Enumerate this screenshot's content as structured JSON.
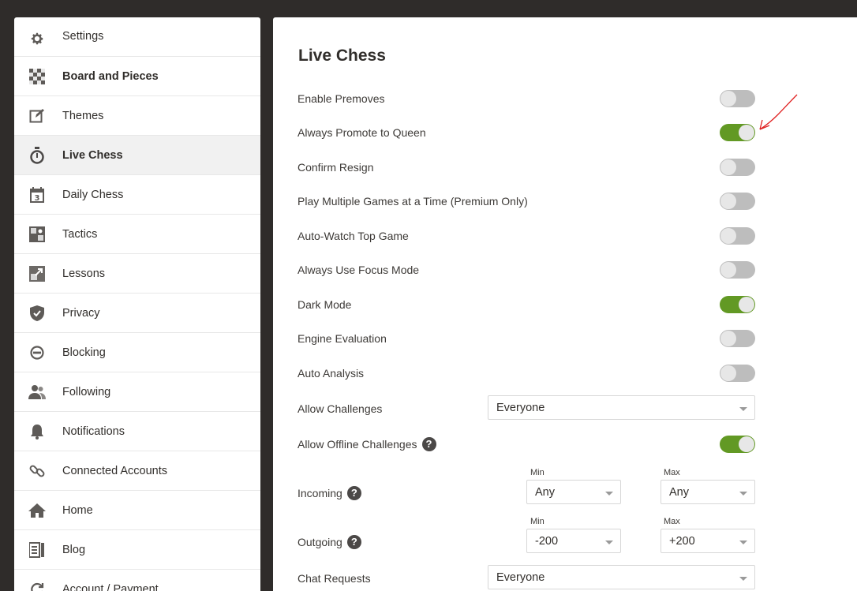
{
  "sidebar": {
    "items": [
      {
        "label": "Settings",
        "icon": "gear-icon"
      },
      {
        "label": "Board and Pieces",
        "icon": "board-icon"
      },
      {
        "label": "Themes",
        "icon": "edit-icon"
      },
      {
        "label": "Live Chess",
        "icon": "stopwatch-icon",
        "active": true
      },
      {
        "label": "Daily Chess",
        "icon": "calendar-icon"
      },
      {
        "label": "Tactics",
        "icon": "puzzle-icon"
      },
      {
        "label": "Lessons",
        "icon": "lessons-icon"
      },
      {
        "label": "Privacy",
        "icon": "shield-icon"
      },
      {
        "label": "Blocking",
        "icon": "block-icon"
      },
      {
        "label": "Following",
        "icon": "people-icon"
      },
      {
        "label": "Notifications",
        "icon": "bell-icon"
      },
      {
        "label": "Connected Accounts",
        "icon": "link-icon"
      },
      {
        "label": "Home",
        "icon": "home-icon"
      },
      {
        "label": "Blog",
        "icon": "blog-icon"
      },
      {
        "label": "Account / Payment",
        "icon": "refresh-icon"
      }
    ]
  },
  "main": {
    "title": "Live Chess",
    "toggles": [
      {
        "label": "Enable Premoves",
        "on": false
      },
      {
        "label": "Always Promote to Queen",
        "on": true
      },
      {
        "label": "Confirm Resign",
        "on": false
      },
      {
        "label": "Play Multiple Games at a Time (Premium Only)",
        "on": false
      },
      {
        "label": "Auto-Watch Top Game",
        "on": false
      },
      {
        "label": "Always Use Focus Mode",
        "on": false
      },
      {
        "label": "Dark Mode",
        "on": true
      },
      {
        "label": "Engine Evaluation",
        "on": false
      },
      {
        "label": "Auto Analysis",
        "on": false
      }
    ],
    "allow_challenges": {
      "label": "Allow Challenges",
      "value": "Everyone"
    },
    "allow_offline": {
      "label": "Allow Offline Challenges",
      "on": true
    },
    "incoming": {
      "label": "Incoming",
      "min_label": "Min",
      "max_label": "Max",
      "min": "Any",
      "max": "Any"
    },
    "outgoing": {
      "label": "Outgoing",
      "min_label": "Min",
      "max_label": "Max",
      "min": "-200",
      "max": "+200"
    },
    "chat_requests": {
      "label": "Chat Requests",
      "value": "Everyone"
    },
    "help_glyph": "?"
  },
  "colors": {
    "toggle_on": "#629924",
    "toggle_off": "#bdbdbd",
    "annotation": "#e02020"
  }
}
